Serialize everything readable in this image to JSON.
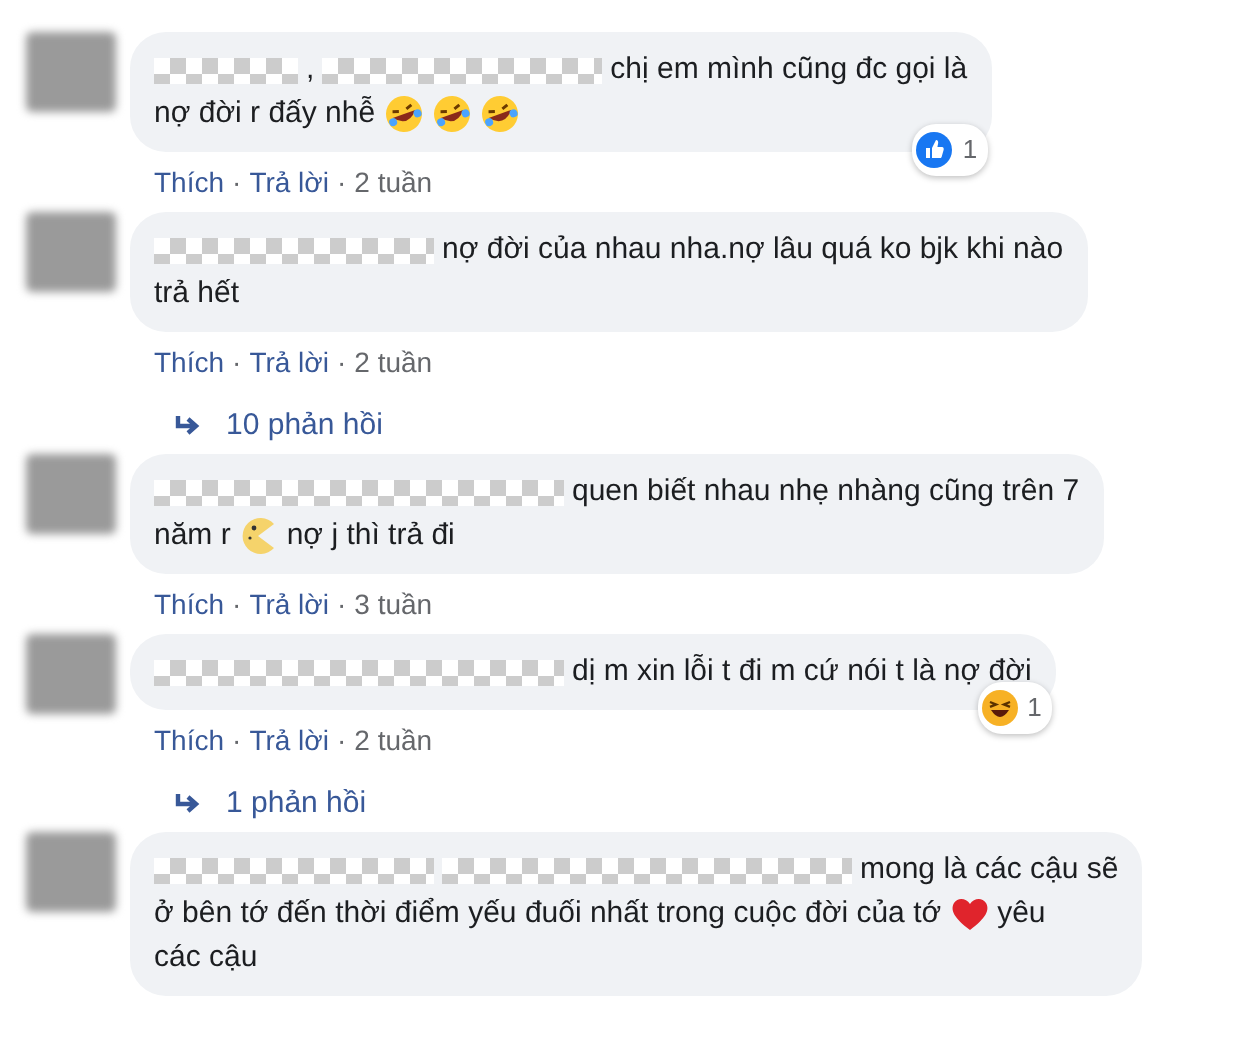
{
  "comments": [
    {
      "lines": [
        [
          {
            "kind": "mask"
          },
          {
            "kind": "text",
            "text": ","
          },
          {
            "kind": "maskwide"
          },
          {
            "kind": "text",
            "text": "chị em mình cũng đc gọi là"
          }
        ],
        [
          {
            "kind": "text",
            "text": "nợ đời r đấy nhễ"
          },
          {
            "kind": "rofl"
          },
          {
            "kind": "rofl"
          },
          {
            "kind": "rofl"
          }
        ]
      ],
      "reaction": {
        "kind": "like",
        "count": "1"
      },
      "meta": [
        {
          "kind": "link",
          "text": "Thích"
        },
        {
          "kind": "dot",
          "text": "·"
        },
        {
          "kind": "link",
          "text": "Trả lời"
        },
        {
          "kind": "dot",
          "text": "·"
        },
        {
          "kind": "time",
          "text": "2 tuần"
        }
      ]
    },
    {
      "lines": [
        [
          {
            "kind": "maskwide"
          },
          {
            "kind": "text",
            "text": "nợ đời của nhau nha.nợ lâu quá ko bjk khi nào"
          }
        ],
        [
          {
            "kind": "text",
            "text": "trả hết"
          }
        ]
      ],
      "meta": [
        {
          "kind": "link",
          "text": "Thích"
        },
        {
          "kind": "dot",
          "text": "·"
        },
        {
          "kind": "link",
          "text": "Trả lời"
        },
        {
          "kind": "dot",
          "text": "·"
        },
        {
          "kind": "time",
          "text": "2 tuần"
        }
      ],
      "replies": "10 phản hồi"
    },
    {
      "lines": [
        [
          {
            "kind": "maskwider"
          },
          {
            "kind": "text",
            "text": "quen biết nhau nhẹ nhàng cũng trên 7"
          }
        ],
        [
          {
            "kind": "text",
            "text": "năm r"
          },
          {
            "kind": "pacman"
          },
          {
            "kind": "text",
            "text": "nợ j thì trả đi"
          }
        ]
      ],
      "meta": [
        {
          "kind": "link",
          "text": "Thích"
        },
        {
          "kind": "dot",
          "text": "·"
        },
        {
          "kind": "link",
          "text": "Trả lời"
        },
        {
          "kind": "dot",
          "text": "·"
        },
        {
          "kind": "time",
          "text": "3 tuần"
        }
      ]
    },
    {
      "lines": [
        [
          {
            "kind": "maskwider"
          },
          {
            "kind": "text",
            "text": "dị m xin lỗi t đi m cứ nói t là nợ đời"
          }
        ]
      ],
      "reaction": {
        "kind": "haha",
        "count": "1"
      },
      "meta": [
        {
          "kind": "link",
          "text": "Thích"
        },
        {
          "kind": "dot",
          "text": "·"
        },
        {
          "kind": "link",
          "text": "Trả lời"
        },
        {
          "kind": "dot",
          "text": "·"
        },
        {
          "kind": "time",
          "text": "2 tuần"
        }
      ],
      "replies": "1 phản hồi"
    },
    {
      "lines": [
        [
          {
            "kind": "maskwide"
          },
          {
            "kind": "maskwider"
          },
          {
            "kind": "text",
            "text": "mong là các cậu sẽ"
          }
        ],
        [
          {
            "kind": "text",
            "text": "ở bên tớ đến thời điểm yếu đuối nhất trong cuộc đời của tớ"
          },
          {
            "kind": "heart"
          },
          {
            "kind": "text",
            "text": "yêu"
          }
        ],
        [
          {
            "kind": "text",
            "text": "các cậu"
          }
        ]
      ]
    }
  ]
}
